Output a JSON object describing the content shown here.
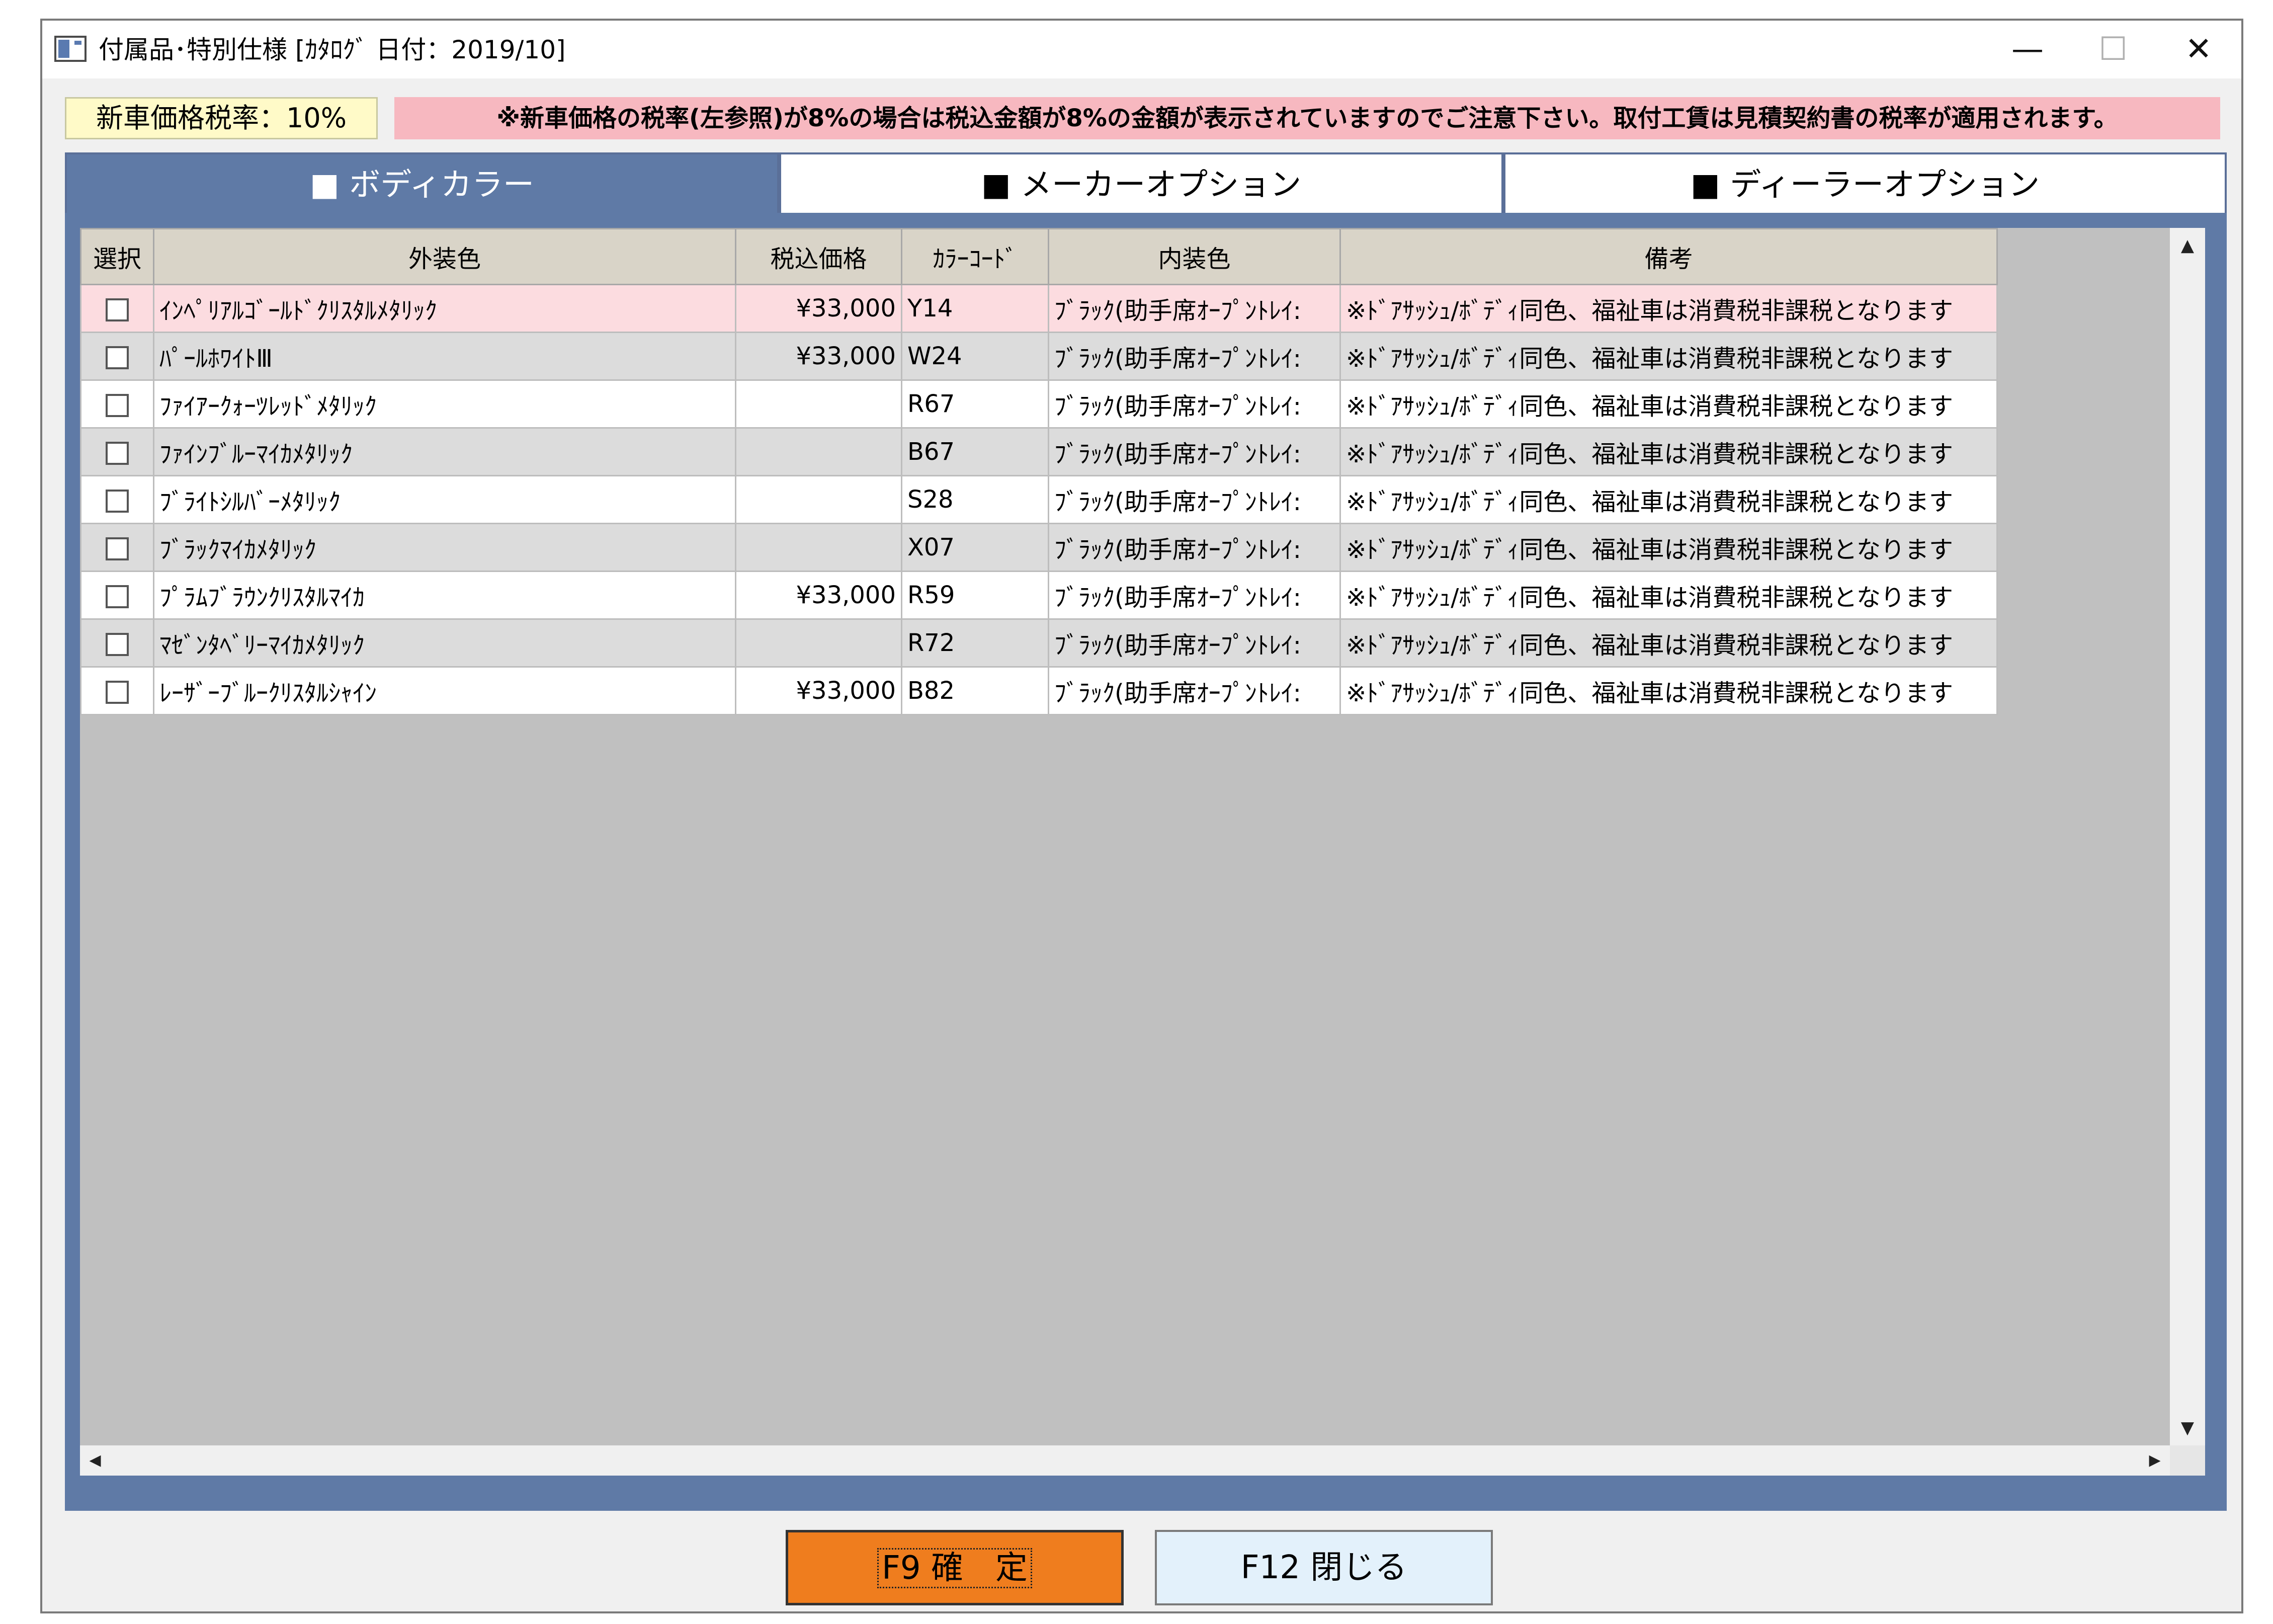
{
  "window": {
    "title": "付属品･特別仕様 [ｶﾀﾛｸﾞ 日付：2019/10]",
    "controls": {
      "minimize": "—",
      "maximize": "☐",
      "close": "✕"
    }
  },
  "tax": {
    "label": "新車価格税率：10%",
    "notice": "※新車価格の税率(左参照)が8%の場合は税込金額が8%の金額が表示されていますのでご注意下さい。取付工賃は見積契約書の税率が適用されます。"
  },
  "tabs": [
    {
      "label": "■ ボディカラー",
      "active": true
    },
    {
      "label": "■ メーカーオプション",
      "active": false
    },
    {
      "label": "■ ディーラーオプション",
      "active": false
    }
  ],
  "grid": {
    "columns": [
      "選択",
      "外装色",
      "税込価格",
      "ｶﾗｰｺｰﾄﾞ",
      "内装色",
      "備考"
    ],
    "rows": [
      {
        "name": "ｲﾝﾍﾟﾘｱﾙｺﾞｰﾙﾄﾞｸﾘｽﾀﾙﾒﾀﾘｯｸ",
        "price": "¥33,000",
        "code": "Y14",
        "interior": "ﾌﾞﾗｯｸ(助手席ｵｰﾌﾟﾝﾄﾚｲ:",
        "note": "※ﾄﾞｱｻｯｼｭ/ﾎﾞﾃﾞｨ同色、福祉車は消費税非課税となります"
      },
      {
        "name": "ﾊﾟｰﾙﾎﾜｲﾄⅢ",
        "price": "¥33,000",
        "code": "W24",
        "interior": "ﾌﾞﾗｯｸ(助手席ｵｰﾌﾟﾝﾄﾚｲ:",
        "note": "※ﾄﾞｱｻｯｼｭ/ﾎﾞﾃﾞｨ同色、福祉車は消費税非課税となります"
      },
      {
        "name": "ﾌｧｲｱｰｸｫｰﾂﾚｯﾄﾞﾒﾀﾘｯｸ",
        "price": "",
        "code": "R67",
        "interior": "ﾌﾞﾗｯｸ(助手席ｵｰﾌﾟﾝﾄﾚｲ:",
        "note": "※ﾄﾞｱｻｯｼｭ/ﾎﾞﾃﾞｨ同色、福祉車は消費税非課税となります"
      },
      {
        "name": "ﾌｧｲﾝﾌﾞﾙｰﾏｲｶﾒﾀﾘｯｸ",
        "price": "",
        "code": "B67",
        "interior": "ﾌﾞﾗｯｸ(助手席ｵｰﾌﾟﾝﾄﾚｲ:",
        "note": "※ﾄﾞｱｻｯｼｭ/ﾎﾞﾃﾞｨ同色、福祉車は消費税非課税となります"
      },
      {
        "name": "ﾌﾞﾗｲﾄｼﾙﾊﾞｰﾒﾀﾘｯｸ",
        "price": "",
        "code": "S28",
        "interior": "ﾌﾞﾗｯｸ(助手席ｵｰﾌﾟﾝﾄﾚｲ:",
        "note": "※ﾄﾞｱｻｯｼｭ/ﾎﾞﾃﾞｨ同色、福祉車は消費税非課税となります"
      },
      {
        "name": "ﾌﾞﾗｯｸﾏｲｶﾒﾀﾘｯｸ",
        "price": "",
        "code": "X07",
        "interior": "ﾌﾞﾗｯｸ(助手席ｵｰﾌﾟﾝﾄﾚｲ:",
        "note": "※ﾄﾞｱｻｯｼｭ/ﾎﾞﾃﾞｨ同色、福祉車は消費税非課税となります"
      },
      {
        "name": "ﾌﾟﾗﾑﾌﾞﾗｳﾝｸﾘｽﾀﾙﾏｲｶ",
        "price": "¥33,000",
        "code": "R59",
        "interior": "ﾌﾞﾗｯｸ(助手席ｵｰﾌﾟﾝﾄﾚｲ:",
        "note": "※ﾄﾞｱｻｯｼｭ/ﾎﾞﾃﾞｨ同色、福祉車は消費税非課税となります"
      },
      {
        "name": "ﾏｾﾞﾝﾀﾍﾞﾘｰﾏｲｶﾒﾀﾘｯｸ",
        "price": "",
        "code": "R72",
        "interior": "ﾌﾞﾗｯｸ(助手席ｵｰﾌﾟﾝﾄﾚｲ:",
        "note": "※ﾄﾞｱｻｯｼｭ/ﾎﾞﾃﾞｨ同色、福祉車は消費税非課税となります"
      },
      {
        "name": "ﾚｰｻﾞｰﾌﾞﾙｰｸﾘｽﾀﾙｼｬｲﾝ",
        "price": "¥33,000",
        "code": "B82",
        "interior": "ﾌﾞﾗｯｸ(助手席ｵｰﾌﾟﾝﾄﾚｲ:",
        "note": "※ﾄﾞｱｻｯｼｭ/ﾎﾞﾃﾞｨ同色、福祉車は消費税非課税となります"
      }
    ]
  },
  "buttons": {
    "confirm": "F9 確　定",
    "close": "F12 閉じる"
  },
  "colors": {
    "tab_active": "#5f7aa6",
    "confirm_button": "#ef7d1e",
    "close_button": "#e3f1fb",
    "notice_bg": "#f7b8c0",
    "tax_bg": "#fffac8",
    "selected_row": "#fcdce0"
  }
}
